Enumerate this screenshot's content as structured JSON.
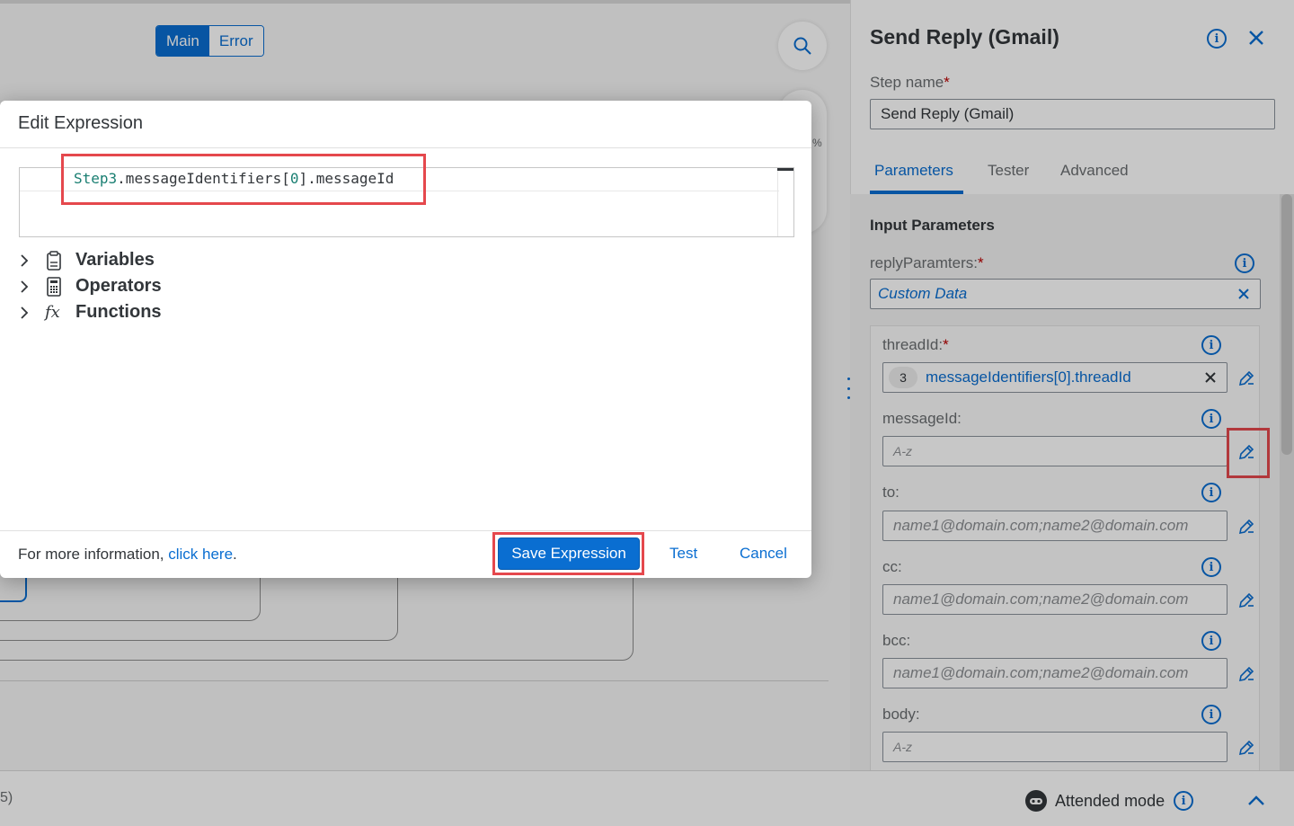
{
  "canvas": {
    "segmented": {
      "main": "Main",
      "error": "Error"
    },
    "zoom_fragment": "%",
    "bottom_left_fragment": "5)"
  },
  "dialog": {
    "title": "Edit Expression",
    "code": {
      "step": "Step3",
      "mid": ".messageIdentifiers[",
      "index": "0",
      "tail": "].messageId"
    },
    "tree": [
      {
        "label": "Variables",
        "icon": "clipboard-icon"
      },
      {
        "label": "Operators",
        "icon": "calculator-icon"
      },
      {
        "label": "Functions",
        "icon": "function-fx-icon"
      }
    ],
    "footer": {
      "info_prefix": "For more information, ",
      "info_link": "click here",
      "info_suffix": ".",
      "save": "Save Expression",
      "test": "Test",
      "cancel": "Cancel"
    }
  },
  "panel": {
    "title": "Send Reply (Gmail)",
    "step_name_label": "Step name",
    "step_name_value": "Send Reply (Gmail)",
    "tabs": [
      "Parameters",
      "Tester",
      "Advanced"
    ],
    "section_title": "Input Parameters",
    "reply_label": "replyParamters:",
    "reply_value": "Custom Data",
    "fields": {
      "threadId": {
        "label": "threadId:",
        "badge": "3",
        "value": "messageIdentifiers[0].threadId"
      },
      "messageId": {
        "label": "messageId:",
        "type_hint": "A-z"
      },
      "to": {
        "label": "to:",
        "placeholder": "name1@domain.com;name2@domain.com"
      },
      "cc": {
        "label": "cc:",
        "placeholder": "name1@domain.com;name2@domain.com"
      },
      "bcc": {
        "label": "bcc:",
        "placeholder": "name1@domain.com;name2@domain.com"
      },
      "body": {
        "label": "body:",
        "type_hint": "A-z"
      }
    }
  },
  "bottombar": {
    "mode": "Attended mode"
  },
  "colors": {
    "accent": "#0a6ed1",
    "highlight": "#e5484d",
    "required": "#bb0000"
  }
}
